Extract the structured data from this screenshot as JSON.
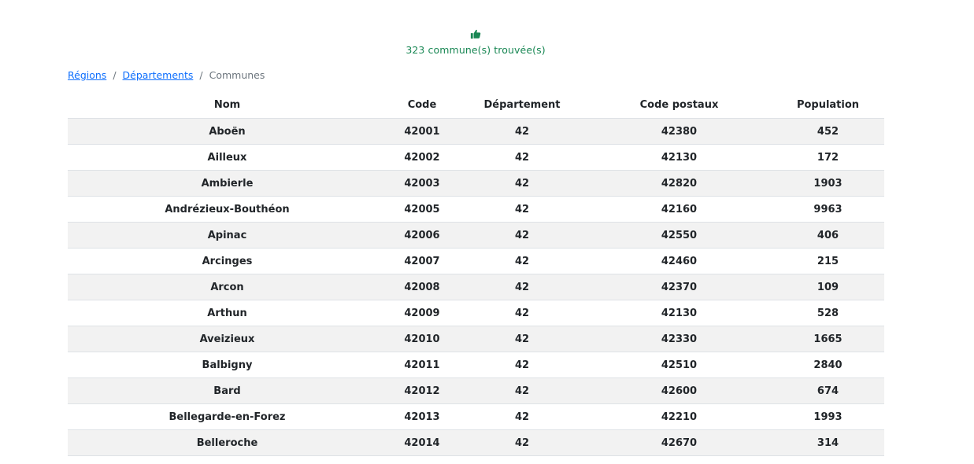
{
  "status": {
    "icon": "thumbs-up-icon",
    "text": "323 commune(s) trouvée(s)",
    "color": "#198754"
  },
  "breadcrumb": {
    "regions": "Régions",
    "separator": "/",
    "departements": "Départements",
    "current": "Communes"
  },
  "table": {
    "headers": {
      "nom": "Nom",
      "code": "Code",
      "departement": "Département",
      "code_postaux": "Code postaux",
      "population": "Population"
    },
    "rows": [
      {
        "nom": "Aboën",
        "code": "42001",
        "departement": "42",
        "code_postal": "42380",
        "population": "452"
      },
      {
        "nom": "Ailleux",
        "code": "42002",
        "departement": "42",
        "code_postal": "42130",
        "population": "172"
      },
      {
        "nom": "Ambierle",
        "code": "42003",
        "departement": "42",
        "code_postal": "42820",
        "population": "1903"
      },
      {
        "nom": "Andrézieux-Bouthéon",
        "code": "42005",
        "departement": "42",
        "code_postal": "42160",
        "population": "9963"
      },
      {
        "nom": "Apinac",
        "code": "42006",
        "departement": "42",
        "code_postal": "42550",
        "population": "406"
      },
      {
        "nom": "Arcinges",
        "code": "42007",
        "departement": "42",
        "code_postal": "42460",
        "population": "215"
      },
      {
        "nom": "Arcon",
        "code": "42008",
        "departement": "42",
        "code_postal": "42370",
        "population": "109"
      },
      {
        "nom": "Arthun",
        "code": "42009",
        "departement": "42",
        "code_postal": "42130",
        "population": "528"
      },
      {
        "nom": "Aveizieux",
        "code": "42010",
        "departement": "42",
        "code_postal": "42330",
        "population": "1665"
      },
      {
        "nom": "Balbigny",
        "code": "42011",
        "departement": "42",
        "code_postal": "42510",
        "population": "2840"
      },
      {
        "nom": "Bard",
        "code": "42012",
        "departement": "42",
        "code_postal": "42600",
        "population": "674"
      },
      {
        "nom": "Bellegarde-en-Forez",
        "code": "42013",
        "departement": "42",
        "code_postal": "42210",
        "population": "1993"
      },
      {
        "nom": "Belleroche",
        "code": "42014",
        "departement": "42",
        "code_postal": "42670",
        "population": "314"
      }
    ]
  }
}
